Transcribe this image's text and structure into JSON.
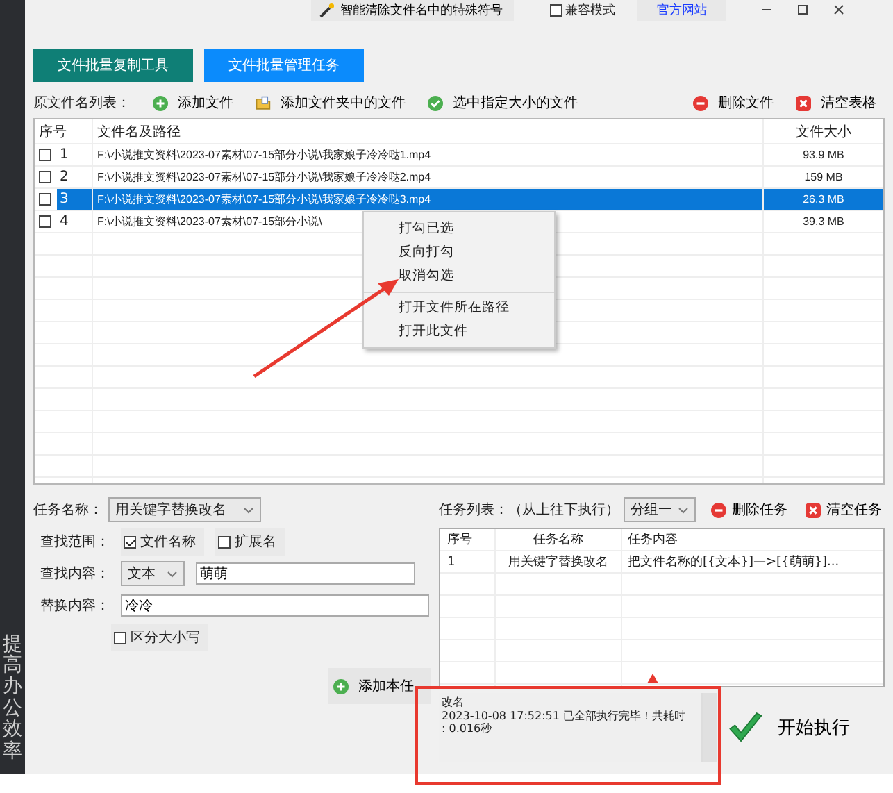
{
  "sidebar": {
    "text": "提高办公效率"
  },
  "top_bar": {
    "clean_button": "智能清除文件名中的特殊符号",
    "compat_mode": {
      "label": "兼容模式",
      "checked": false
    },
    "site_link": "官方网站"
  },
  "tabs": [
    {
      "label": "文件批量复制工具",
      "selected": false
    },
    {
      "label": "文件批量管理任务",
      "selected": true
    }
  ],
  "file_toolbar": {
    "label": "原文件名列表：",
    "actions": [
      {
        "kind": "add",
        "label": "添加文件"
      },
      {
        "kind": "folder",
        "label": "添加文件夹中的文件"
      },
      {
        "kind": "check",
        "label": "选中指定大小的文件"
      },
      {
        "kind": "remove",
        "label": "删除文件"
      },
      {
        "kind": "clear",
        "label": "清空表格"
      }
    ]
  },
  "file_table": {
    "columns": [
      "序号",
      "文件名及路径",
      "文件大小"
    ],
    "rows": [
      {
        "index": "1",
        "path": "F:\\小说推文资料\\2023-07素材\\07-15部分小说\\我家娘子冷冷哒1.mp4",
        "size": "93.9 MB",
        "checked": false,
        "selected": false
      },
      {
        "index": "2",
        "path": "F:\\小说推文资料\\2023-07素材\\07-15部分小说\\我家娘子冷冷哒2.mp4",
        "size": "159 MB",
        "checked": false,
        "selected": false
      },
      {
        "index": "3",
        "path": "F:\\小说推文资料\\2023-07素材\\07-15部分小说\\我家娘子冷冷哒3.mp4",
        "size": "26.3 MB",
        "checked": false,
        "selected": true
      },
      {
        "index": "4",
        "path": "F:\\小说推文资料\\2023-07素材\\07-15部分小说\\",
        "size": "39.3 MB",
        "checked": false,
        "selected": false
      }
    ]
  },
  "context_menu": {
    "items": [
      {
        "label": "打勾已选",
        "separator_before": false
      },
      {
        "label": "反向打勾",
        "separator_before": false
      },
      {
        "label": "取消勾选",
        "separator_before": false
      },
      {
        "label": "打开文件所在路径",
        "separator_before": true
      },
      {
        "label": "打开此文件",
        "separator_before": false
      }
    ]
  },
  "task_form": {
    "name_label": "任务名称：",
    "name_value": "用关键字替换改名",
    "scope_label": "查找范围：",
    "scope_options": [
      {
        "label": "文件名称",
        "checked": true
      },
      {
        "label": "扩展名",
        "checked": false
      }
    ],
    "find_label": "查找内容：",
    "find_type": "文本",
    "find_value": "萌萌",
    "replace_label": "替换内容：",
    "replace_value": "冷冷",
    "case_sensitive": {
      "label": "区分大小写",
      "checked": false
    },
    "add_button": "添加本任"
  },
  "task_panel": {
    "label": "任务列表：（从上往下执行）",
    "group": "分组一",
    "actions": [
      {
        "kind": "remove",
        "label": "删除任务"
      },
      {
        "kind": "clear",
        "label": "清空任务"
      }
    ],
    "columns": [
      "序号",
      "任务名称",
      "任务内容"
    ],
    "rows": [
      {
        "index": "1",
        "name": "用关键字替换改名",
        "content": "把文件名称的[{文本}]—>[{萌萌}]..."
      }
    ]
  },
  "log": {
    "lines": [
      "改名",
      "2023-10-08 17:52:51 已全部执行完毕！共耗时",
      ": 0.016秒"
    ]
  },
  "start_button": "开始执行"
}
